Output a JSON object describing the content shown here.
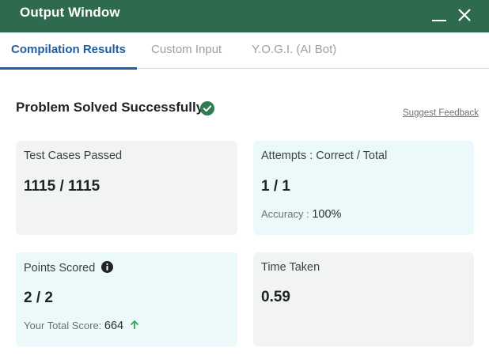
{
  "window": {
    "title": "Output Window"
  },
  "tabs": [
    {
      "label": "Compilation Results",
      "active": true
    },
    {
      "label": "Custom Input",
      "active": false
    },
    {
      "label": "Y.O.G.I. (AI Bot)",
      "active": false
    }
  ],
  "status": {
    "text": "Problem Solved Successfully",
    "icon": "check-circle-icon",
    "feedback_link": "Suggest Feedback"
  },
  "cards": {
    "test_cases": {
      "label": "Test Cases Passed",
      "value": "1115 / 1115"
    },
    "attempts": {
      "label": "Attempts : Correct / Total",
      "value": "1 / 1",
      "sub_label": "Accuracy :",
      "sub_value": "100%"
    },
    "points": {
      "label": "Points Scored",
      "value": "2 / 2",
      "sub_label": "Your Total Score:",
      "sub_value": "664",
      "info_icon": "info-icon",
      "trend_icon": "arrow-up-icon"
    },
    "time": {
      "label": "Time Taken",
      "value": "0.59"
    }
  },
  "colors": {
    "titlebar": "#2e6a4e",
    "active_tab": "#1f5fa0",
    "success": "#2e7d4f",
    "trend_up": "#2fa84f",
    "card_grey": "#f1f4f3",
    "card_blue": "#ebf9fb"
  }
}
